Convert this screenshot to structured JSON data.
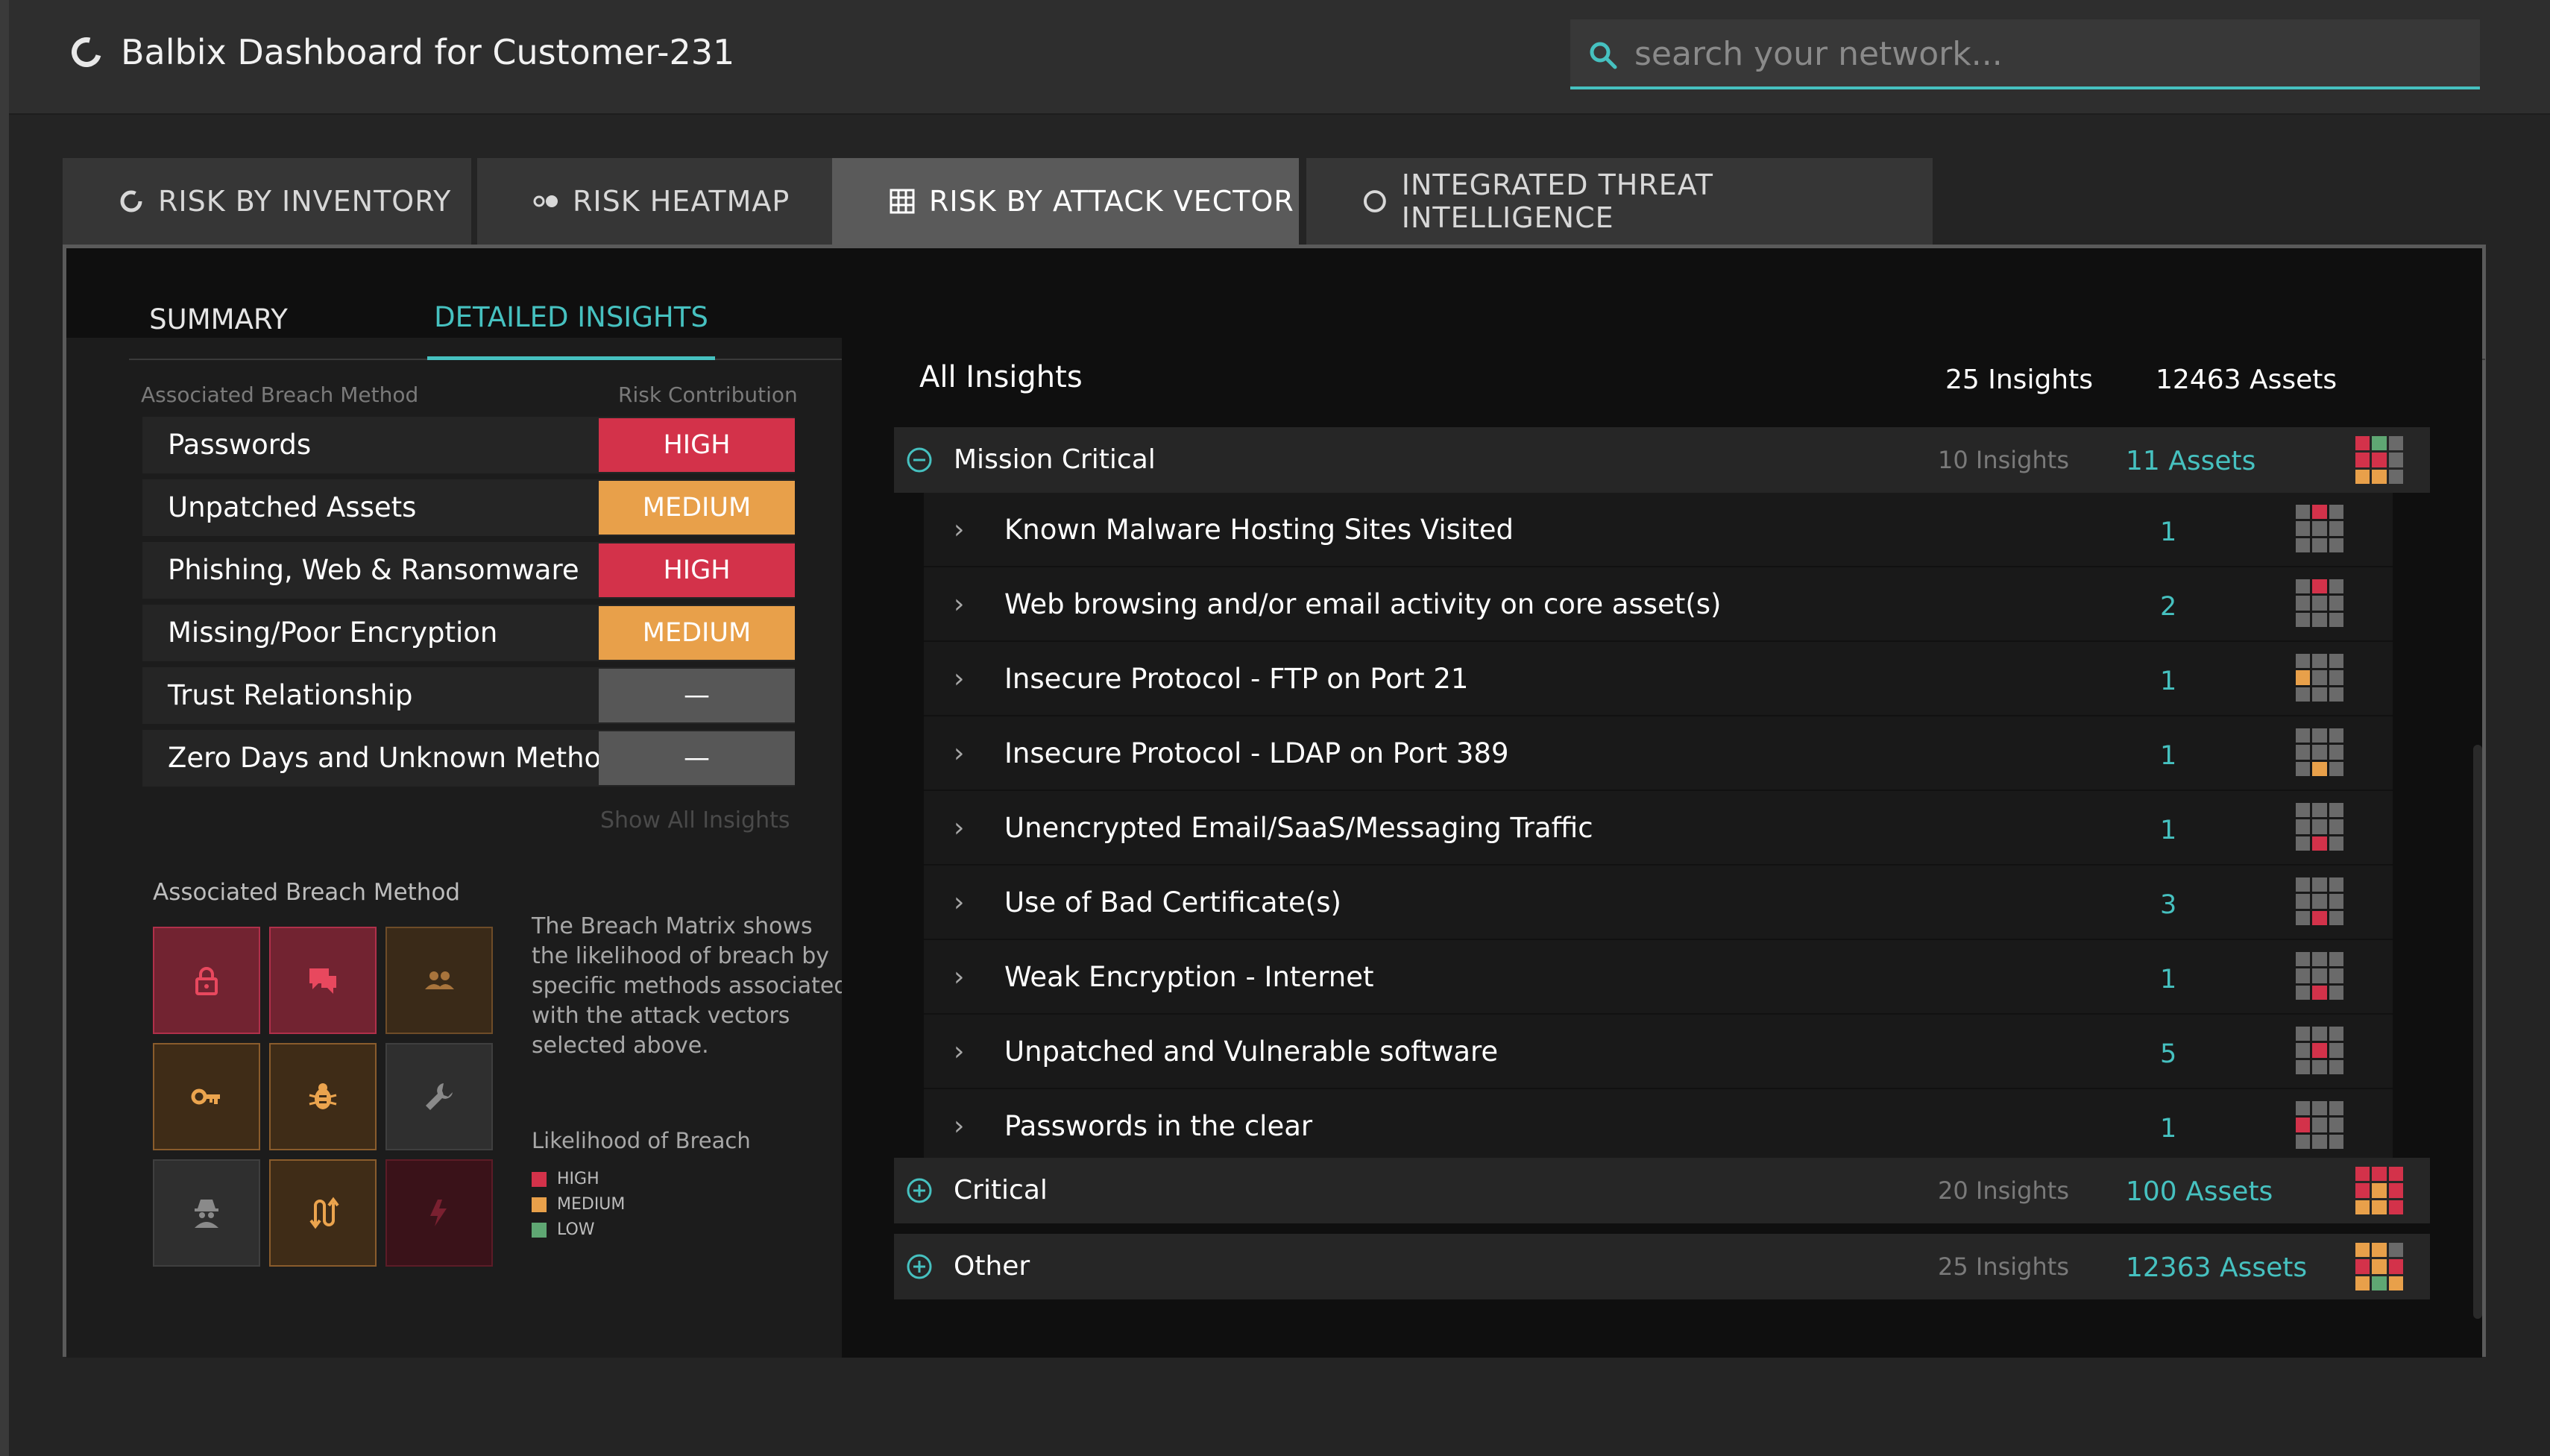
{
  "header": {
    "title": "Balbix Dashboard for Customer-231",
    "search_placeholder": "search your network..."
  },
  "tabs": [
    {
      "label": "RISK BY INVENTORY",
      "icon": "refresh-ring-icon"
    },
    {
      "label": "RISK HEATMAP",
      "icon": "dots-icon"
    },
    {
      "label": "RISK BY ATTACK VECTOR",
      "icon": "grid-icon",
      "active": true
    },
    {
      "label": "INTEGRATED THREAT INTELLIGENCE",
      "icon": "circle-icon"
    }
  ],
  "subtabs": [
    {
      "label": "SUMMARY"
    },
    {
      "label": "DETAILED INSIGHTS",
      "active": true
    }
  ],
  "breach": {
    "col_method": "Associated Breach Method",
    "col_risk": "Risk Contribution",
    "rows": [
      {
        "label": "Passwords",
        "risk": "HIGH",
        "color": "#d3324a"
      },
      {
        "label": "Unpatched Assets",
        "risk": "MEDIUM",
        "color": "#e8a04a"
      },
      {
        "label": "Phishing, Web & Ransomware",
        "risk": "HIGH",
        "color": "#d3324a"
      },
      {
        "label": "Missing/Poor Encryption",
        "risk": "MEDIUM",
        "color": "#e8a04a"
      },
      {
        "label": "Trust Relationship",
        "risk": "—",
        "color": "#575757"
      },
      {
        "label": "Zero Days and Unknown Methods",
        "risk": "—",
        "color": "#575757"
      }
    ],
    "show_all": "Show All Insights"
  },
  "matrix": {
    "title": "Associated Breach Method",
    "description": "The Breach Matrix shows the likelihood of breach by specific methods associated with the attack vectors selected above.",
    "likelihood_title": "Likelihood of Breach",
    "legend": [
      {
        "label": "HIGH",
        "color": "#d3324a"
      },
      {
        "label": "MEDIUM",
        "color": "#e8a04a"
      },
      {
        "label": "LOW",
        "color": "#5fa773"
      }
    ],
    "cells": [
      {
        "icon": "lock-icon",
        "level": "high"
      },
      {
        "icon": "chat-icon",
        "level": "high"
      },
      {
        "icon": "people-icon",
        "level": "medium-dim"
      },
      {
        "icon": "key-icon",
        "level": "medium"
      },
      {
        "icon": "bug-icon",
        "level": "medium"
      },
      {
        "icon": "wrench-icon",
        "level": "none"
      },
      {
        "icon": "spy-icon",
        "level": "none"
      },
      {
        "icon": "arrows-icon",
        "level": "medium"
      },
      {
        "icon": "bolt-icon",
        "level": "high-dim"
      }
    ]
  },
  "insights": {
    "title": "All Insights",
    "total_insights": "25 Insights",
    "total_assets": "12463 Assets",
    "groups": [
      {
        "name": "Mission Critical",
        "insights": "10 Insights",
        "assets": "11 Assets",
        "expanded": true
      },
      {
        "name": "Critical",
        "insights": "20 Insights",
        "assets": "100 Assets",
        "expanded": false
      },
      {
        "name": "Other",
        "insights": "25 Insights",
        "assets": "12363 Assets",
        "expanded": false
      }
    ],
    "rows": [
      {
        "name": "Known Malware Hosting Sites Visited",
        "count": "1"
      },
      {
        "name": "Web browsing and/or email activity on core asset(s)",
        "count": "2"
      },
      {
        "name": "Insecure Protocol - FTP on Port 21",
        "count": "1"
      },
      {
        "name": "Insecure Protocol - LDAP on Port 389",
        "count": "1"
      },
      {
        "name": "Unencrypted Email/SaaS/Messaging Traffic",
        "count": "1"
      },
      {
        "name": "Use of Bad Certificate(s)",
        "count": "3"
      },
      {
        "name": "Weak Encryption - Internet",
        "count": "1"
      },
      {
        "name": "Unpatched and Vulnerable software",
        "count": "5"
      },
      {
        "name": "Passwords in the clear",
        "count": "1"
      }
    ]
  }
}
